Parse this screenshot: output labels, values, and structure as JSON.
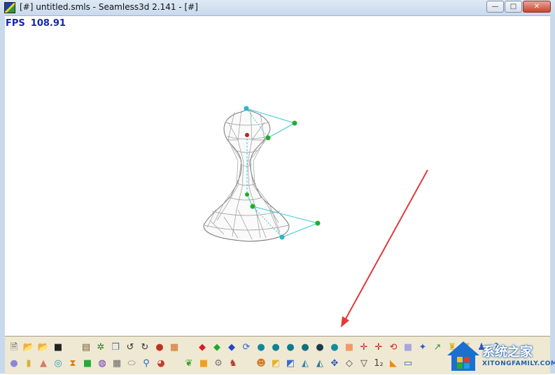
{
  "window": {
    "title": "[#] untitled.smls - Seamless3d 2.141 - [#]",
    "minimize": "—",
    "maximize": "□",
    "close": "✕"
  },
  "fps": {
    "label": "FPS",
    "value": "108.91"
  },
  "toolbar": {
    "row1": [
      {
        "name": "new-file-icon",
        "glyph": "🗎",
        "color": "#555"
      },
      {
        "name": "open-folder-icon",
        "glyph": "📂",
        "color": "#d9a21b"
      },
      {
        "name": "open-folder-alt-icon",
        "glyph": "📂",
        "color": "#c98d1b"
      },
      {
        "name": "save-disk-icon",
        "glyph": "■",
        "color": "#222"
      },
      {
        "name": "gap",
        "glyph": ""
      },
      {
        "name": "import-icon",
        "glyph": "▤",
        "color": "#7a5a2a"
      },
      {
        "name": "tree-icon",
        "glyph": "✲",
        "color": "#2a7a2a"
      },
      {
        "name": "copy-icon",
        "glyph": "❐",
        "color": "#4a6fa8"
      },
      {
        "name": "undo-icon",
        "glyph": "↺",
        "color": "#333"
      },
      {
        "name": "redo-icon",
        "glyph": "↻",
        "color": "#333"
      },
      {
        "name": "sphere-material-icon",
        "glyph": "●",
        "color": "#c0331b"
      },
      {
        "name": "brick-texture-icon",
        "glyph": "▦",
        "color": "#d06a1a"
      },
      {
        "name": "gap",
        "glyph": ""
      },
      {
        "name": "red-diamond-icon",
        "glyph": "◆",
        "color": "#d42020"
      },
      {
        "name": "green-diamond-icon",
        "glyph": "◆",
        "color": "#1faa2a"
      },
      {
        "name": "blue-diamond-icon",
        "glyph": "◆",
        "color": "#2244c8"
      },
      {
        "name": "rotate-axes-icon",
        "glyph": "⟳",
        "color": "#2266cc"
      },
      {
        "name": "teal-face-icon",
        "glyph": "●",
        "color": "#118899"
      },
      {
        "name": "teal-face-2-icon",
        "glyph": "●",
        "color": "#117f90"
      },
      {
        "name": "teal-face-3-icon",
        "glyph": "●",
        "color": "#0f7a8a"
      },
      {
        "name": "teal-face-4-icon",
        "glyph": "●",
        "color": "#11707f"
      },
      {
        "name": "dark-face-icon",
        "glyph": "●",
        "color": "#1b3b48"
      },
      {
        "name": "teal-face-5-icon",
        "glyph": "●",
        "color": "#138c9c"
      },
      {
        "name": "orange-block-icon",
        "glyph": "■",
        "color": "#f09a6a"
      },
      {
        "name": "red-split-icon",
        "glyph": "✛",
        "color": "#d42020"
      },
      {
        "name": "red-join-icon",
        "glyph": "✛",
        "color": "#c41818"
      },
      {
        "name": "red-loop-icon",
        "glyph": "⟲",
        "color": "#cc2020"
      },
      {
        "name": "lilac-block-icon",
        "glyph": "■",
        "color": "#a6a6e0"
      },
      {
        "name": "blue-star-icon",
        "glyph": "✦",
        "color": "#2d5fd0"
      },
      {
        "name": "green-arrow-icon",
        "glyph": "↗",
        "color": "#2a9a2a"
      },
      {
        "name": "yellow-figure-icon",
        "glyph": "♜",
        "color": "#d6b21a"
      },
      {
        "name": "yellow-figure-2-icon",
        "glyph": "♜",
        "color": "#c8a418"
      },
      {
        "name": "blue-figure-icon",
        "glyph": "♟",
        "color": "#3356b8"
      },
      {
        "name": "help-icon",
        "glyph": "?",
        "color": "#2750b0"
      }
    ],
    "row2": [
      {
        "name": "lilac-sphere-icon",
        "glyph": "●",
        "color": "#8b86d8"
      },
      {
        "name": "cylinder-icon",
        "glyph": "▮",
        "color": "#d8b23a"
      },
      {
        "name": "cone-icon",
        "glyph": "▲",
        "color": "#d87a6a"
      },
      {
        "name": "torus-icon",
        "glyph": "◎",
        "color": "#18a0b8"
      },
      {
        "name": "hourglass-icon",
        "glyph": "⧗",
        "color": "#e07a10"
      },
      {
        "name": "green-cube-icon",
        "glyph": "■",
        "color": "#2aa838"
      },
      {
        "name": "ring-icon",
        "glyph": "◍",
        "color": "#6a2aa8"
      },
      {
        "name": "grid-icon",
        "glyph": "▦",
        "color": "#666"
      },
      {
        "name": "capsule-icon",
        "glyph": "⬭",
        "color": "#777"
      },
      {
        "name": "pin-icon",
        "glyph": "⚲",
        "color": "#2266cc"
      },
      {
        "name": "mesh-blob-icon",
        "glyph": "◕",
        "color": "#c83a2a"
      },
      {
        "name": "gap",
        "glyph": ""
      },
      {
        "name": "leaf-icon",
        "glyph": "❦",
        "color": "#3aa02a"
      },
      {
        "name": "orange-square-icon",
        "glyph": "■",
        "color": "#f0a020"
      },
      {
        "name": "gear-icon",
        "glyph": "⚙",
        "color": "#777"
      },
      {
        "name": "character-icon",
        "glyph": "♞",
        "color": "#b83a2a"
      },
      {
        "name": "gap",
        "glyph": ""
      },
      {
        "name": "face-icon",
        "glyph": "☻",
        "color": "#d07a2a"
      },
      {
        "name": "color-tile-icon",
        "glyph": "◩",
        "color": "#e8b020"
      },
      {
        "name": "color-tile-2-icon",
        "glyph": "◩",
        "color": "#3a6ad0"
      },
      {
        "name": "pointer-triangle-icon",
        "glyph": "◭",
        "color": "#2a8aa8"
      },
      {
        "name": "pointer-triangle-2-icon",
        "glyph": "◭",
        "color": "#2a7898"
      },
      {
        "name": "move-arrows-icon",
        "glyph": "✥",
        "color": "#2a5ab8"
      },
      {
        "name": "diamond-outline-icon",
        "glyph": "◇",
        "color": "#444"
      },
      {
        "name": "triangle-outline-icon",
        "glyph": "▽",
        "color": "#444"
      },
      {
        "name": "one-two-icon",
        "glyph": "1₂",
        "color": "#444"
      },
      {
        "name": "orange-triangle-icon",
        "glyph": "◣",
        "color": "#f08a10"
      },
      {
        "name": "screen-icon",
        "glyph": "▭",
        "color": "#2a5ab8"
      }
    ]
  },
  "watermark": {
    "main": "系统之家",
    "sub": "XITONGFAMILY.COM"
  }
}
